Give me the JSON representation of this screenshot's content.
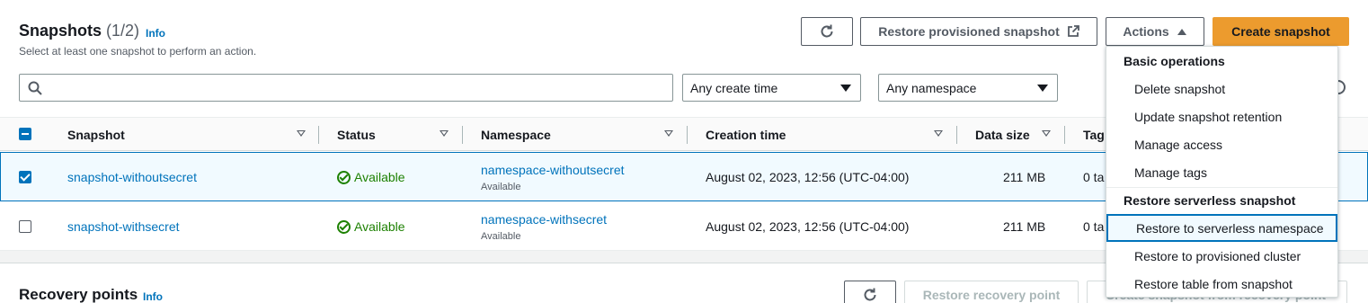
{
  "snapshots": {
    "title": "Snapshots",
    "count": "(1/2)",
    "info": "Info",
    "subtitle": "Select at least one snapshot to perform an action.",
    "refresh_icon": "refresh-icon",
    "restore_provisioned_label": "Restore provisioned snapshot",
    "actions_label": "Actions",
    "create_label": "Create snapshot",
    "search_placeholder": "",
    "filter_time": "Any create time",
    "filter_namespace": "Any namespace",
    "columns": [
      "Snapshot",
      "Status",
      "Namespace",
      "Creation time",
      "Data size",
      "Tag"
    ],
    "rows": [
      {
        "name": "snapshot-withoutsecret",
        "status": "Available",
        "namespace": "namespace-withoutsecret",
        "namespace_status": "Available",
        "created": "August 02, 2023, 12:56 (UTC-04:00)",
        "size": "211 MB",
        "tags": "0 ta",
        "checked": true
      },
      {
        "name": "snapshot-withsecret",
        "status": "Available",
        "namespace": "namespace-withsecret",
        "namespace_status": "Available",
        "created": "August 02, 2023, 12:56 (UTC-04:00)",
        "size": "211 MB",
        "tags": "0 ta",
        "checked": false
      }
    ]
  },
  "actions_menu": {
    "group1": "Basic operations",
    "group1_items": [
      "Delete snapshot",
      "Update snapshot retention",
      "Manage access",
      "Manage tags"
    ],
    "group2": "Restore serverless snapshot",
    "group2_items": [
      "Restore to serverless namespace",
      "Restore to provisioned cluster",
      "Restore table from snapshot"
    ]
  },
  "recovery": {
    "title": "Recovery points",
    "info": "Info",
    "restore_label": "Restore recovery point",
    "create_label": "Create snapshot from recovery point"
  },
  "colors": {
    "accent": "#0073bb",
    "primary": "#ec9b2e",
    "success": "#1d8102"
  }
}
